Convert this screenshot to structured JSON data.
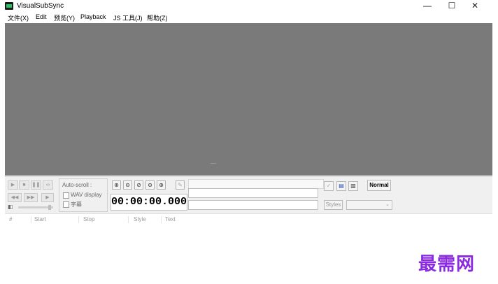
{
  "window": {
    "title": "VisualSubSync",
    "minimize_glyph": "—",
    "maximize_glyph": "☐",
    "close_glyph": "✕"
  },
  "menu": [
    "文件(X)",
    "Edit",
    "预览(Y)",
    "Playback",
    "JS 工具(J)",
    "帮助(Z)"
  ],
  "transport": {
    "play": "▶",
    "stop": "■",
    "pause": "❚❚",
    "loop": "∞",
    "rewind": "◀◀",
    "forward": "▶▶",
    "next": "▶"
  },
  "autoscroll": {
    "label": "Auto-scroll :",
    "wav_display": "WAV display",
    "subtitles": "字幕"
  },
  "zoom_icons": [
    "zoom-in-icon",
    "zoom-out-icon",
    "zoom-selection-icon",
    "zoom-vertical-icon",
    "zoom-all-icon"
  ],
  "zoom_glyphs": [
    "⊕",
    "⊖",
    "⊘",
    "⊖",
    "⊕"
  ],
  "time_display": "00:00:00.000",
  "right_controls": {
    "styles_label": "Styles",
    "normal_label": "Normal",
    "check_glyph": "✓",
    "edit_glyph": "▤",
    "note_glyph": "▥"
  },
  "list_columns": [
    "#",
    "Start",
    "Stop",
    "Style",
    "Text"
  ],
  "watermark": "最需网"
}
